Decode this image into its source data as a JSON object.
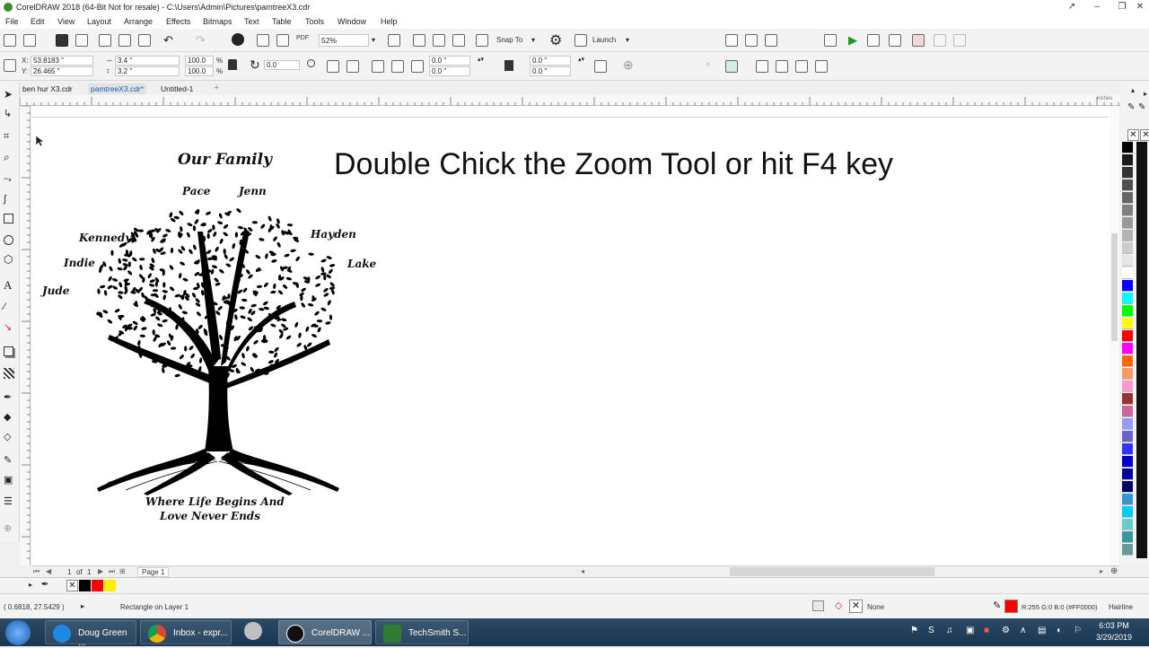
{
  "window": {
    "title": "CorelDRAW 2018 (64-Bit Not for resale) - C:\\Users\\Admin\\Pictures\\pamtreeX3.cdr",
    "minimize_glyph": "–",
    "restore_glyph": "❐",
    "close_glyph": "✕"
  },
  "menu": [
    "File",
    "Edit",
    "View",
    "Layout",
    "Arrange",
    "Effects",
    "Bitmaps",
    "Text",
    "Table",
    "Tools",
    "Window",
    "Help"
  ],
  "toolbar": {
    "zoom_level": "52%",
    "snap_to": "Snap To",
    "launch": "Launch",
    "pdf_label": "PDF"
  },
  "properties": {
    "x": "53.8183 \"",
    "y": "26.465 \"",
    "width": "3.4 \"",
    "height": "3.2 \"",
    "scale_w": "100.0",
    "scale_h": "100.0",
    "pct": "%",
    "rotation": "0.0",
    "corner1": "0.0 \"",
    "corner2": "0.0 \"",
    "corner3": "0.0 \"",
    "corner4": "0.0 \""
  },
  "tabs": [
    {
      "label": "ben hur X3.cdr",
      "active": false
    },
    {
      "label": "pamtreeX3.cdr*",
      "active": true
    },
    {
      "label": "Untitled-1",
      "active": false
    }
  ],
  "ruler_unit": "inches",
  "artwork": {
    "heading": "Our Family",
    "names": {
      "pace": "Pace",
      "jenn": "Jenn",
      "kennedy": "Kennedy",
      "hayden": "Hayden",
      "indie": "Indie",
      "lake": "Lake",
      "jude": "Jude"
    },
    "tagline_1": "Where Life Begins And",
    "tagline_2": "Love Never Ends"
  },
  "headline": "Double Chick the Zoom Tool or hit F4 key",
  "pagenav": {
    "current": "1",
    "of": "of",
    "total": "1",
    "page_tab": "Page 1"
  },
  "status": {
    "coords": "( 0.6818, 27.5429 )",
    "selection": "Rectangle on Layer 1",
    "fill": "None",
    "outline": "R:255 G:0 B:0 (#FF0000)",
    "outline_width": "Hairline"
  },
  "taskbar": {
    "items": [
      "Doug Green ...",
      "Inbox - expr...",
      "CorelDRAW ...",
      "TechSmith S..."
    ],
    "time": "6:03 PM",
    "date": "3/29/2019"
  },
  "colors": {
    "accent": "#1a5fb4",
    "outline_red": "#ff0000",
    "palette": [
      "#000000",
      "#1a1a1a",
      "#333333",
      "#4d4d4d",
      "#666666",
      "#808080",
      "#999999",
      "#b3b3b3",
      "#cccccc",
      "#e6e6e6",
      "#ffffff",
      "#0000ff",
      "#00ffff",
      "#00ff00",
      "#ffff00",
      "#ff0000",
      "#ff00ff",
      "#ff6600",
      "#ff9966",
      "#ff99cc",
      "#993333",
      "#cc6699",
      "#9999ff",
      "#6666cc",
      "#3333ff",
      "#0000cc",
      "#000099",
      "#000066",
      "#3399cc",
      "#00ccff",
      "#66cccc",
      "#339999",
      "#669999"
    ]
  }
}
